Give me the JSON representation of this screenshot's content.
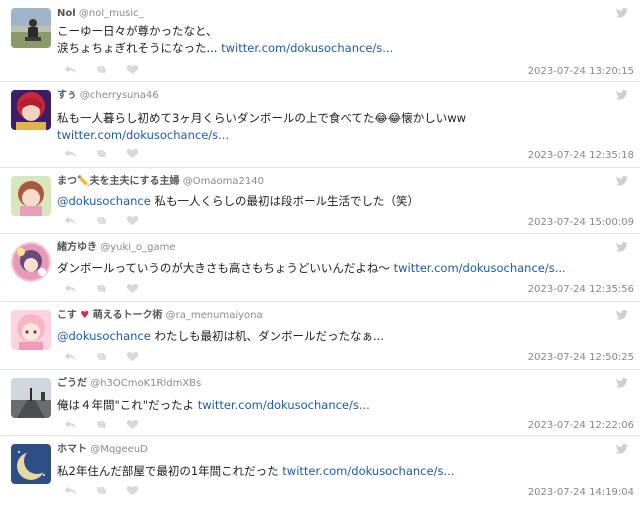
{
  "tweets": [
    {
      "name": "Nol",
      "handle": "@nol_music_",
      "line1": "こーゆー日々が尊かったなと、",
      "line2_text": "涙ちょちょぎれそうになった... ",
      "line2_link": "twitter.com/dokusochance/s...",
      "time": "2023-07-24 13:20:15",
      "avatar_icon": "avatar-person-field"
    },
    {
      "name": "すぅ",
      "handle": "@cherrysuna46",
      "line1": "私も一人暮らし初めて3ヶ月くらいダンボールの上で食べてた😂😂懐かしいww",
      "line2_link": "twitter.com/dokusochance/s...",
      "time": "2023-07-24 12:35:18",
      "avatar_icon": "avatar-anime-red"
    },
    {
      "name": "まつ✏️夫を主夫にする主婦",
      "handle": "@Omaoma2140",
      "mention": "@dokusochance",
      "line1": " 私も一人くらしの最初は段ボール生活でした（笑）",
      "time": "2023-07-24 15:00:09",
      "avatar_icon": "avatar-anime-girl"
    },
    {
      "name": "緒方ゆき",
      "handle": "@yuki_o_game",
      "line1": "ダンボールっていうのが大きさも高さもちょうどいいんだよね〜 ",
      "line1_link": "twitter.com/dokusochance/s...",
      "time": "2023-07-24 12:35:56",
      "avatar_icon": "avatar-anime-circle"
    },
    {
      "name": "こす",
      "name_heart": "♥",
      "name_suffix": " 萌えるトーク術",
      "handle": "@ra_menumaiyona",
      "mention": "@dokusochance",
      "line1": " わたしも最初は机、ダンボールだったなぁ...",
      "time": "2023-07-24 12:50:25",
      "avatar_icon": "avatar-anime-pink"
    },
    {
      "name": "ごうだ",
      "handle": "@h3OCmoK1RldmXBs",
      "line1": "俺は４年間\"これ\"だったよ ",
      "line1_link": "twitter.com/dokusochance/s...",
      "time": "2023-07-24 12:22:06",
      "avatar_icon": "avatar-road"
    },
    {
      "name": "ホマト",
      "handle": "@MqgeeuD",
      "line1": "私2年住んだ部屋で最初の1年間これだった ",
      "line1_link": "twitter.com/dokusochance/s...",
      "time": "2023-07-24 14:19:04",
      "avatar_icon": "avatar-moon"
    }
  ],
  "icons": {
    "reply": "reply-icon",
    "retweet": "retweet-icon",
    "like": "heart-icon",
    "brand": "twitter-bird-icon"
  },
  "colors": {
    "link": "#1f5aa8",
    "action_icon": "#d8d8d8",
    "heart": "#d8304a"
  }
}
